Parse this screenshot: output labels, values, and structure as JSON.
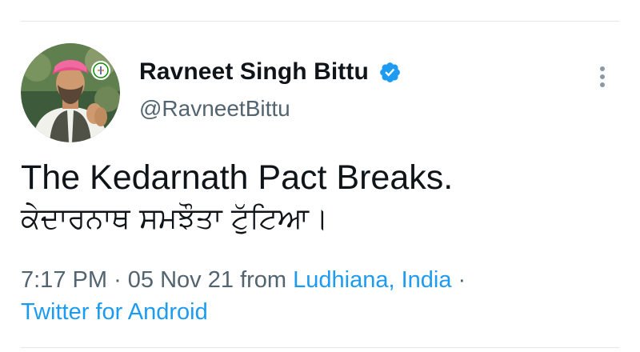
{
  "tweet": {
    "author": {
      "display_name": "Ravneet Singh Bittu",
      "handle": "@RavneetBittu",
      "verified_icon": "verified-badge-icon",
      "avatar": "profile-photo"
    },
    "text_line_1": "The Kedarnath Pact Breaks.",
    "text_line_2": "ਕੇਦਾਰਨਾਥ ਸਮਝੌਤਾ ਟੁੱਟਿਆ।",
    "meta": {
      "time": "7:17 PM",
      "separator": "·",
      "date": "05 Nov 21",
      "from_label": "from",
      "location": "Ludhiana, India",
      "source": "Twitter for Android"
    },
    "more_icon": "more-vertical-icon"
  },
  "colors": {
    "text_primary": "#0f1419",
    "text_secondary": "#536471",
    "accent_link": "#1d9bf0",
    "verified_blue": "#1d9bf0",
    "divider": "#e4e7ea"
  }
}
